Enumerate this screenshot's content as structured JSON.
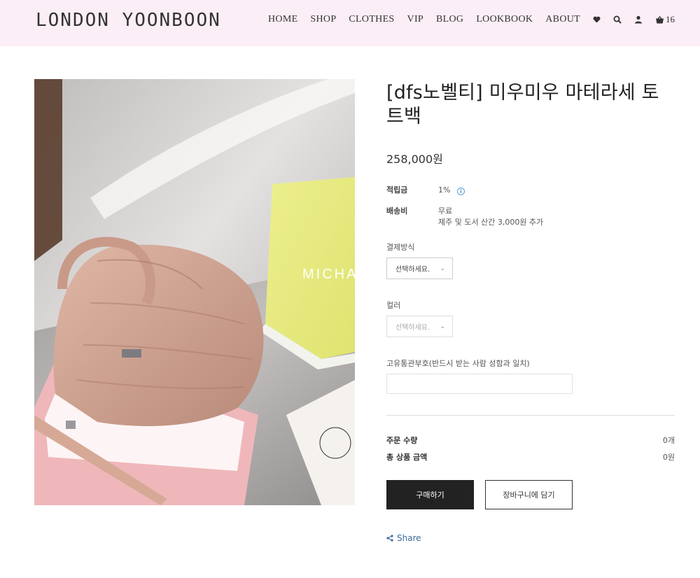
{
  "header": {
    "logo": "LONDON YOONBOON",
    "nav": [
      "HOME",
      "SHOP",
      "CLOTHES",
      "VIP",
      "BLOG",
      "LOOKBOOK",
      "ABOUT"
    ],
    "cart_count": "16"
  },
  "product": {
    "title": "[dfs노벨티] 미우미우 마테라세 토트백",
    "price": "258,000원",
    "points_label": "적립금",
    "points_value": "1%",
    "shipping_label": "배송비",
    "shipping_value": "무료",
    "shipping_note": "제주 및 도서 산간 3,000원 추가",
    "image_text": "MICHA"
  },
  "options": {
    "payment_label": "결제방식",
    "payment_select": "선택하세요.",
    "color_label": "컬러",
    "color_select": "선택하세요.",
    "customs_label": "고유통관부호(반드시 받는 사람 성함과 일치)",
    "customs_value": ""
  },
  "summary": {
    "quantity_label": "주문 수량",
    "quantity_value": "0개",
    "total_label": "총 상품 금액",
    "total_value": "0원"
  },
  "actions": {
    "buy_label": "구매하기",
    "cart_label": "장바구니에 담기",
    "share_label": "Share"
  },
  "colors": {
    "header_bg": "#fbeef6",
    "buy_button_bg": "#222222",
    "share_link": "#3b6a9a",
    "info_icon": "#5b9bd5"
  }
}
